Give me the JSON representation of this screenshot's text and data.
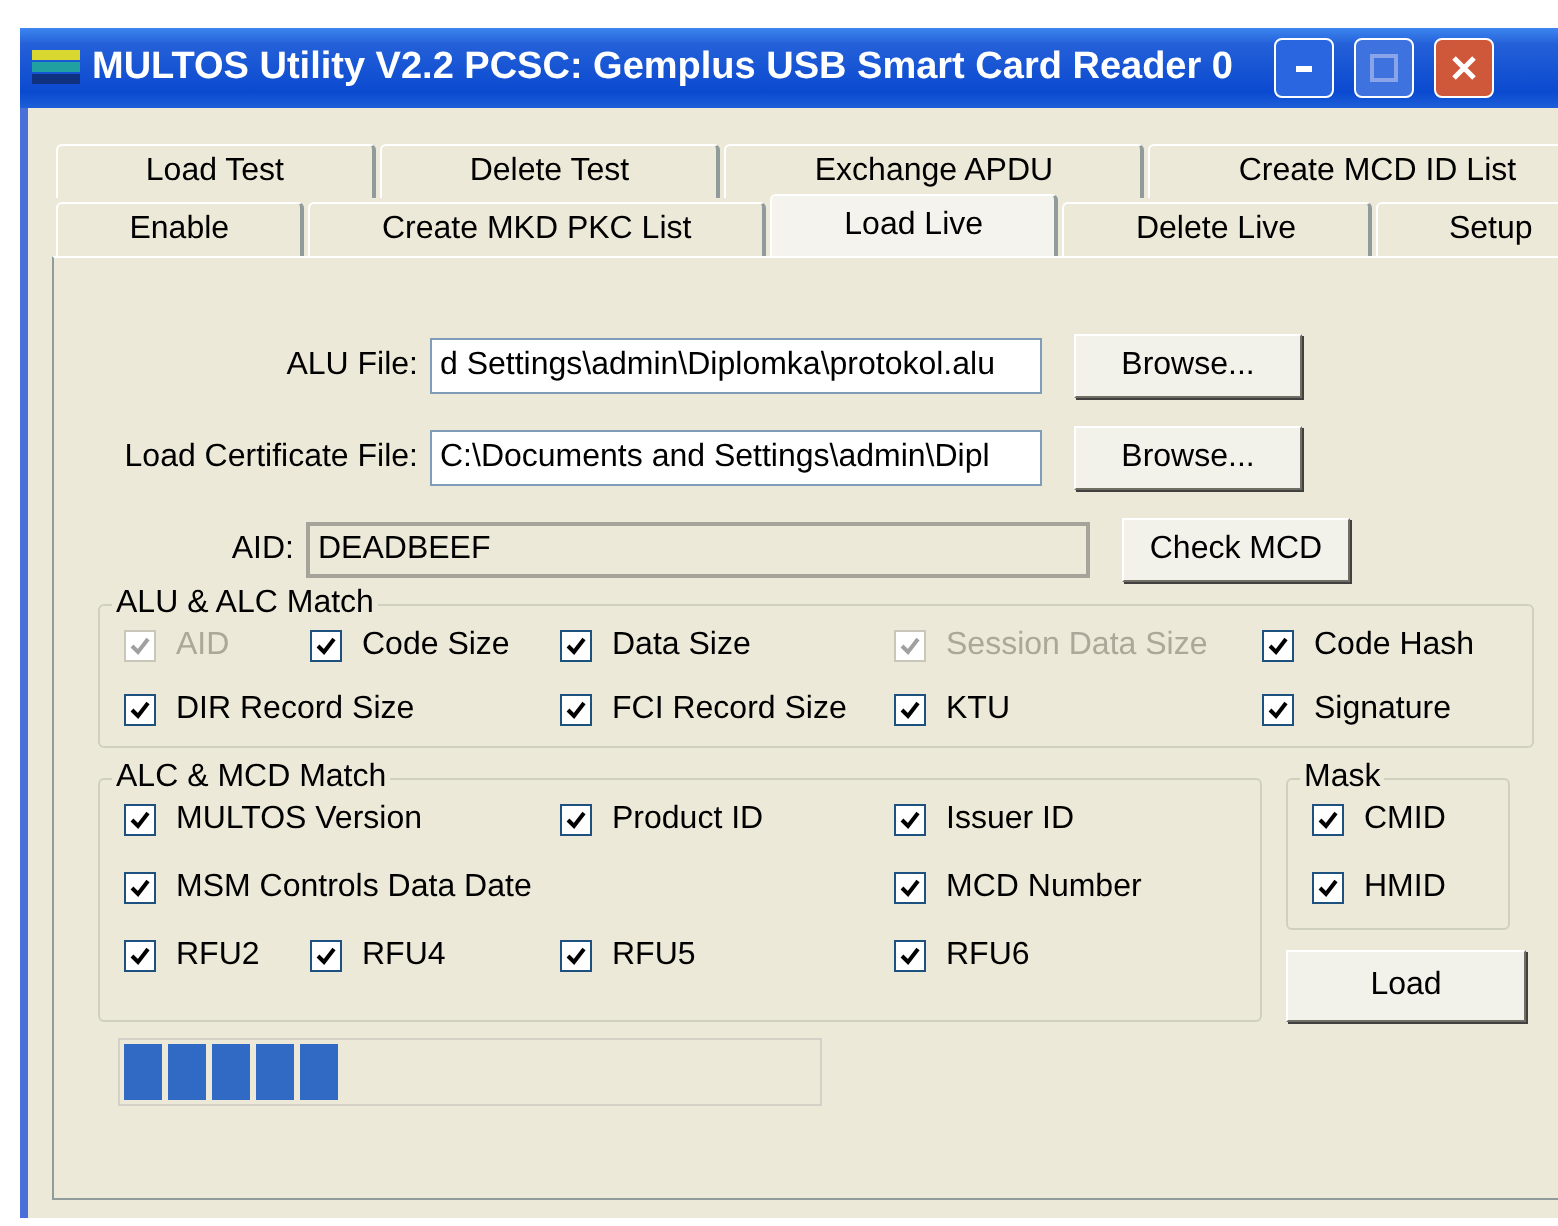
{
  "window": {
    "title": "MULTOS Utility V2.2 PCSC: Gemplus USB Smart Card Reader 0"
  },
  "tab_rows": [
    [
      {
        "label": "Load Test",
        "selected": false
      },
      {
        "label": "Delete Test",
        "selected": false
      },
      {
        "label": "Exchange APDU",
        "selected": false
      },
      {
        "label": "Create MCD ID List",
        "selected": false
      }
    ],
    [
      {
        "label": "Enable",
        "selected": false
      },
      {
        "label": "Create MKD PKC List",
        "selected": false
      },
      {
        "label": "Load Live",
        "selected": true
      },
      {
        "label": "Delete Live",
        "selected": false
      },
      {
        "label": "Setup",
        "selected": false
      }
    ]
  ],
  "fields": [
    {
      "label": "ALU File:",
      "value": "d Settings\\admin\\Diplomka\\protokol.alu",
      "button": "Browse...",
      "disabled": false
    },
    {
      "label": "Load Certificate File:",
      "value": "C:\\Documents and Settings\\admin\\Dipl",
      "button": "Browse...",
      "disabled": false
    },
    {
      "label": "AID:",
      "value": "DEADBEEF",
      "button": "Check MCD",
      "disabled": true
    }
  ],
  "alu_alc_match": {
    "title": "ALU & ALC Match",
    "items": [
      {
        "label": "AID",
        "checked": true,
        "disabled": true
      },
      {
        "label": "Code Size",
        "checked": true,
        "disabled": false
      },
      {
        "label": "Data Size",
        "checked": true,
        "disabled": false
      },
      {
        "label": "Session Data Size",
        "checked": true,
        "disabled": true
      },
      {
        "label": "Code Hash",
        "checked": true,
        "disabled": false
      },
      {
        "label": "DIR Record Size",
        "checked": true,
        "disabled": false
      },
      {
        "label": "FCI Record Size",
        "checked": true,
        "disabled": false
      },
      {
        "label": "KTU",
        "checked": true,
        "disabled": false
      },
      {
        "label": "Signature",
        "checked": true,
        "disabled": false
      }
    ]
  },
  "alc_mcd_match": {
    "title": "ALC & MCD Match",
    "items": [
      {
        "label": "MULTOS Version",
        "checked": true,
        "disabled": false
      },
      {
        "label": "Product ID",
        "checked": true,
        "disabled": false
      },
      {
        "label": "Issuer ID",
        "checked": true,
        "disabled": false
      },
      {
        "label": "MSM Controls Data Date",
        "checked": true,
        "disabled": false
      },
      {
        "label": "MCD Number",
        "checked": true,
        "disabled": false
      },
      {
        "label": "RFU2",
        "checked": true,
        "disabled": false
      },
      {
        "label": "RFU4",
        "checked": true,
        "disabled": false
      },
      {
        "label": "RFU5",
        "checked": true,
        "disabled": false
      },
      {
        "label": "RFU6",
        "checked": true,
        "disabled": false
      }
    ]
  },
  "mask": {
    "title": "Mask",
    "items": [
      {
        "label": "CMID",
        "checked": true,
        "disabled": false
      },
      {
        "label": "HMID",
        "checked": true,
        "disabled": false
      }
    ]
  },
  "load_button": "Load",
  "progress": {
    "level": 0.3125
  }
}
